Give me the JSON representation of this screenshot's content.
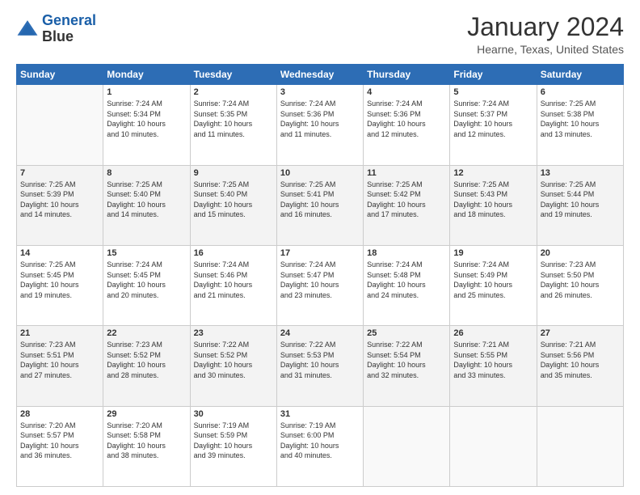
{
  "logo": {
    "line1": "General",
    "line2": "Blue"
  },
  "title": "January 2024",
  "location": "Hearne, Texas, United States",
  "days_header": [
    "Sunday",
    "Monday",
    "Tuesday",
    "Wednesday",
    "Thursday",
    "Friday",
    "Saturday"
  ],
  "weeks": [
    [
      {
        "num": "",
        "info": ""
      },
      {
        "num": "1",
        "info": "Sunrise: 7:24 AM\nSunset: 5:34 PM\nDaylight: 10 hours\nand 10 minutes."
      },
      {
        "num": "2",
        "info": "Sunrise: 7:24 AM\nSunset: 5:35 PM\nDaylight: 10 hours\nand 11 minutes."
      },
      {
        "num": "3",
        "info": "Sunrise: 7:24 AM\nSunset: 5:36 PM\nDaylight: 10 hours\nand 11 minutes."
      },
      {
        "num": "4",
        "info": "Sunrise: 7:24 AM\nSunset: 5:36 PM\nDaylight: 10 hours\nand 12 minutes."
      },
      {
        "num": "5",
        "info": "Sunrise: 7:24 AM\nSunset: 5:37 PM\nDaylight: 10 hours\nand 12 minutes."
      },
      {
        "num": "6",
        "info": "Sunrise: 7:25 AM\nSunset: 5:38 PM\nDaylight: 10 hours\nand 13 minutes."
      }
    ],
    [
      {
        "num": "7",
        "info": "Sunrise: 7:25 AM\nSunset: 5:39 PM\nDaylight: 10 hours\nand 14 minutes."
      },
      {
        "num": "8",
        "info": "Sunrise: 7:25 AM\nSunset: 5:40 PM\nDaylight: 10 hours\nand 14 minutes."
      },
      {
        "num": "9",
        "info": "Sunrise: 7:25 AM\nSunset: 5:40 PM\nDaylight: 10 hours\nand 15 minutes."
      },
      {
        "num": "10",
        "info": "Sunrise: 7:25 AM\nSunset: 5:41 PM\nDaylight: 10 hours\nand 16 minutes."
      },
      {
        "num": "11",
        "info": "Sunrise: 7:25 AM\nSunset: 5:42 PM\nDaylight: 10 hours\nand 17 minutes."
      },
      {
        "num": "12",
        "info": "Sunrise: 7:25 AM\nSunset: 5:43 PM\nDaylight: 10 hours\nand 18 minutes."
      },
      {
        "num": "13",
        "info": "Sunrise: 7:25 AM\nSunset: 5:44 PM\nDaylight: 10 hours\nand 19 minutes."
      }
    ],
    [
      {
        "num": "14",
        "info": "Sunrise: 7:25 AM\nSunset: 5:45 PM\nDaylight: 10 hours\nand 19 minutes."
      },
      {
        "num": "15",
        "info": "Sunrise: 7:24 AM\nSunset: 5:45 PM\nDaylight: 10 hours\nand 20 minutes."
      },
      {
        "num": "16",
        "info": "Sunrise: 7:24 AM\nSunset: 5:46 PM\nDaylight: 10 hours\nand 21 minutes."
      },
      {
        "num": "17",
        "info": "Sunrise: 7:24 AM\nSunset: 5:47 PM\nDaylight: 10 hours\nand 23 minutes."
      },
      {
        "num": "18",
        "info": "Sunrise: 7:24 AM\nSunset: 5:48 PM\nDaylight: 10 hours\nand 24 minutes."
      },
      {
        "num": "19",
        "info": "Sunrise: 7:24 AM\nSunset: 5:49 PM\nDaylight: 10 hours\nand 25 minutes."
      },
      {
        "num": "20",
        "info": "Sunrise: 7:23 AM\nSunset: 5:50 PM\nDaylight: 10 hours\nand 26 minutes."
      }
    ],
    [
      {
        "num": "21",
        "info": "Sunrise: 7:23 AM\nSunset: 5:51 PM\nDaylight: 10 hours\nand 27 minutes."
      },
      {
        "num": "22",
        "info": "Sunrise: 7:23 AM\nSunset: 5:52 PM\nDaylight: 10 hours\nand 28 minutes."
      },
      {
        "num": "23",
        "info": "Sunrise: 7:22 AM\nSunset: 5:52 PM\nDaylight: 10 hours\nand 30 minutes."
      },
      {
        "num": "24",
        "info": "Sunrise: 7:22 AM\nSunset: 5:53 PM\nDaylight: 10 hours\nand 31 minutes."
      },
      {
        "num": "25",
        "info": "Sunrise: 7:22 AM\nSunset: 5:54 PM\nDaylight: 10 hours\nand 32 minutes."
      },
      {
        "num": "26",
        "info": "Sunrise: 7:21 AM\nSunset: 5:55 PM\nDaylight: 10 hours\nand 33 minutes."
      },
      {
        "num": "27",
        "info": "Sunrise: 7:21 AM\nSunset: 5:56 PM\nDaylight: 10 hours\nand 35 minutes."
      }
    ],
    [
      {
        "num": "28",
        "info": "Sunrise: 7:20 AM\nSunset: 5:57 PM\nDaylight: 10 hours\nand 36 minutes."
      },
      {
        "num": "29",
        "info": "Sunrise: 7:20 AM\nSunset: 5:58 PM\nDaylight: 10 hours\nand 38 minutes."
      },
      {
        "num": "30",
        "info": "Sunrise: 7:19 AM\nSunset: 5:59 PM\nDaylight: 10 hours\nand 39 minutes."
      },
      {
        "num": "31",
        "info": "Sunrise: 7:19 AM\nSunset: 6:00 PM\nDaylight: 10 hours\nand 40 minutes."
      },
      {
        "num": "",
        "info": ""
      },
      {
        "num": "",
        "info": ""
      },
      {
        "num": "",
        "info": ""
      }
    ]
  ]
}
